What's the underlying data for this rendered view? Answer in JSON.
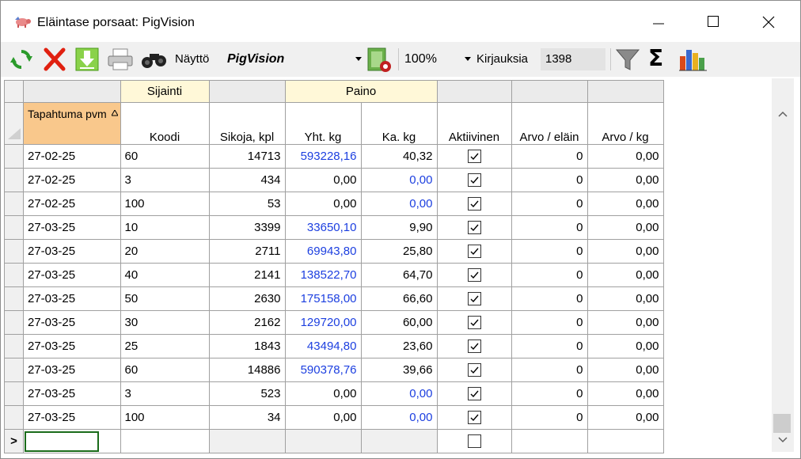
{
  "window": {
    "title": "Eläintase porsaat: PigVision"
  },
  "toolbar": {
    "refresh_icon": "refresh-icon",
    "delete_icon": "delete-icon",
    "import_icon": "download-icon",
    "print_icon": "printer-icon",
    "binoculars_icon": "binoculars-icon",
    "view_label": "Näyttö",
    "view_value": "PigVision",
    "settings_icon": "document-settings-icon",
    "zoom_value": "100%",
    "records_label": "Kirjauksia",
    "records_count": "1398",
    "filter_icon": "filter-icon",
    "sum_label": "Σ",
    "chart_icon": "bar-chart-icon"
  },
  "grid": {
    "group_headers": {
      "location": "Sijainti",
      "weight": "Paino"
    },
    "columns": {
      "date": "Tapahtuma pvm",
      "code": "Koodi",
      "pigs": "Sikoja, kpl",
      "total_kg": "Yht. kg",
      "avg_kg": "Ka. kg",
      "active": "Aktiivinen",
      "value_per_animal": "Arvo / eläin",
      "value_per_kg": "Arvo / kg"
    },
    "rows": [
      {
        "date": "27-02-25",
        "code": "60",
        "pigs": "14713",
        "total_kg": "593228,16",
        "avg_kg": "40,32",
        "active": true,
        "value_animal": "0",
        "value_kg": "0,00",
        "total_blue": true,
        "avg_blue": false
      },
      {
        "date": "27-02-25",
        "code": "3",
        "pigs": "434",
        "total_kg": "0,00",
        "avg_kg": "0,00",
        "active": true,
        "value_animal": "0",
        "value_kg": "0,00",
        "total_blue": false,
        "avg_blue": true
      },
      {
        "date": "27-02-25",
        "code": "100",
        "pigs": "53",
        "total_kg": "0,00",
        "avg_kg": "0,00",
        "active": true,
        "value_animal": "0",
        "value_kg": "0,00",
        "total_blue": false,
        "avg_blue": true
      },
      {
        "date": "27-03-25",
        "code": "10",
        "pigs": "3399",
        "total_kg": "33650,10",
        "avg_kg": "9,90",
        "active": true,
        "value_animal": "0",
        "value_kg": "0,00",
        "total_blue": true,
        "avg_blue": false
      },
      {
        "date": "27-03-25",
        "code": "20",
        "pigs": "2711",
        "total_kg": "69943,80",
        "avg_kg": "25,80",
        "active": true,
        "value_animal": "0",
        "value_kg": "0,00",
        "total_blue": true,
        "avg_blue": false
      },
      {
        "date": "27-03-25",
        "code": "40",
        "pigs": "2141",
        "total_kg": "138522,70",
        "avg_kg": "64,70",
        "active": true,
        "value_animal": "0",
        "value_kg": "0,00",
        "total_blue": true,
        "avg_blue": false
      },
      {
        "date": "27-03-25",
        "code": "50",
        "pigs": "2630",
        "total_kg": "175158,00",
        "avg_kg": "66,60",
        "active": true,
        "value_animal": "0",
        "value_kg": "0,00",
        "total_blue": true,
        "avg_blue": false
      },
      {
        "date": "27-03-25",
        "code": "30",
        "pigs": "2162",
        "total_kg": "129720,00",
        "avg_kg": "60,00",
        "active": true,
        "value_animal": "0",
        "value_kg": "0,00",
        "total_blue": true,
        "avg_blue": false
      },
      {
        "date": "27-03-25",
        "code": "25",
        "pigs": "1843",
        "total_kg": "43494,80",
        "avg_kg": "23,60",
        "active": true,
        "value_animal": "0",
        "value_kg": "0,00",
        "total_blue": true,
        "avg_blue": false
      },
      {
        "date": "27-03-25",
        "code": "60",
        "pigs": "14886",
        "total_kg": "590378,76",
        "avg_kg": "39,66",
        "active": true,
        "value_animal": "0",
        "value_kg": "0,00",
        "total_blue": true,
        "avg_blue": false
      },
      {
        "date": "27-03-25",
        "code": "3",
        "pigs": "523",
        "total_kg": "0,00",
        "avg_kg": "0,00",
        "active": true,
        "value_animal": "0",
        "value_kg": "0,00",
        "total_blue": false,
        "avg_blue": true
      },
      {
        "date": "27-03-25",
        "code": "100",
        "pigs": "34",
        "total_kg": "0,00",
        "avg_kg": "0,00",
        "active": true,
        "value_animal": "0",
        "value_kg": "0,00",
        "total_blue": false,
        "avg_blue": true
      }
    ],
    "new_row_marker": ">"
  },
  "colors": {
    "sorted_header": "#f9c88c",
    "group_header_yellow": "#fff8d8",
    "computed_value_blue": "#1c3fe0",
    "edit_cell_border": "#1a6b1a"
  }
}
